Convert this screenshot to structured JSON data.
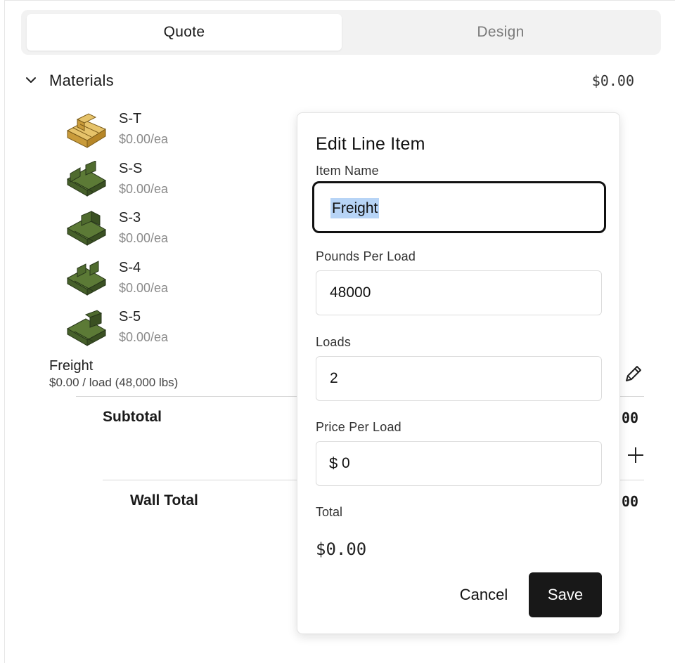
{
  "tabs": [
    {
      "label": "Quote",
      "active": true
    },
    {
      "label": "Design",
      "active": false
    }
  ],
  "materials": {
    "title": "Materials",
    "total": "$0.00",
    "items": [
      {
        "name": "S-T",
        "price": "$0.00/ea",
        "color": "#d9b35a"
      },
      {
        "name": "S-S",
        "price": "$0.00/ea",
        "color": "#4f6b2e"
      },
      {
        "name": "S-3",
        "price": "$0.00/ea",
        "color": "#4f6b2e"
      },
      {
        "name": "S-4",
        "price": "$0.00/ea",
        "color": "#4f6b2e"
      },
      {
        "name": "S-5",
        "price": "$0.00/ea",
        "color": "#4f6b2e"
      }
    ]
  },
  "freight": {
    "name": "Freight",
    "detail": "$0.00 / load (48,000 lbs)"
  },
  "summary": {
    "subtotal_label": "Subtotal",
    "subtotal_value": "00",
    "wall_total_label": "Wall Total",
    "wall_total_value": "00"
  },
  "modal": {
    "title": "Edit Line Item",
    "item_name_label": "Item Name",
    "item_name_value": "Freight",
    "pounds_label": "Pounds Per Load",
    "pounds_value": "48000",
    "loads_label": "Loads",
    "loads_value": "2",
    "price_label": "Price Per Load",
    "price_prefix": "$",
    "price_value": "0",
    "total_label": "Total",
    "total_value": "$0.00",
    "cancel_label": "Cancel",
    "save_label": "Save"
  }
}
